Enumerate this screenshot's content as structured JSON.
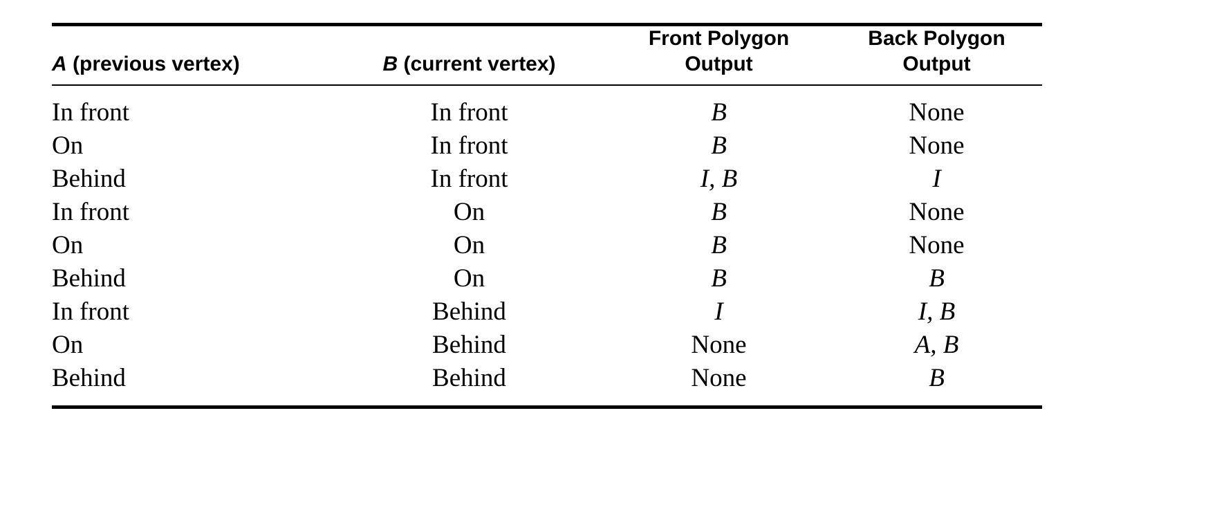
{
  "table": {
    "columns": [
      {
        "id": "a",
        "label_prefix": "A",
        "label_rest": " (previous vertex)",
        "align": "left"
      },
      {
        "id": "b",
        "label_prefix": "B",
        "label_rest": " (current vertex)",
        "align": "center"
      },
      {
        "id": "fp",
        "line1": "Front Polygon",
        "line2": "Output",
        "align": "center"
      },
      {
        "id": "bp",
        "line1": "Back Polygon",
        "line2": "Output",
        "align": "center"
      }
    ],
    "rows": [
      {
        "a": "In front",
        "b": "In front",
        "front": "B",
        "front_italic": true,
        "back": "None",
        "back_italic": false
      },
      {
        "a": "On",
        "b": "In front",
        "front": "B",
        "front_italic": true,
        "back": "None",
        "back_italic": false
      },
      {
        "a": "Behind",
        "b": "In front",
        "front": "I, B",
        "front_italic": true,
        "back": "I",
        "back_italic": true
      },
      {
        "a": "In front",
        "b": "On",
        "front": "B",
        "front_italic": true,
        "back": "None",
        "back_italic": false
      },
      {
        "a": "On",
        "b": "On",
        "front": "B",
        "front_italic": true,
        "back": "None",
        "back_italic": false
      },
      {
        "a": "Behind",
        "b": "On",
        "front": "B",
        "front_italic": true,
        "back": "B",
        "back_italic": true
      },
      {
        "a": "In front",
        "b": "Behind",
        "front": "I",
        "front_italic": true,
        "back": "I, B",
        "back_italic": true
      },
      {
        "a": "On",
        "b": "Behind",
        "front": "None",
        "front_italic": false,
        "back": "A, B",
        "back_italic": true
      },
      {
        "a": "Behind",
        "b": "Behind",
        "front": "None",
        "front_italic": false,
        "back": "B",
        "back_italic": true
      }
    ]
  },
  "style": {
    "text_color": "#000000",
    "background": "#ffffff",
    "rule_color": "#000000"
  }
}
